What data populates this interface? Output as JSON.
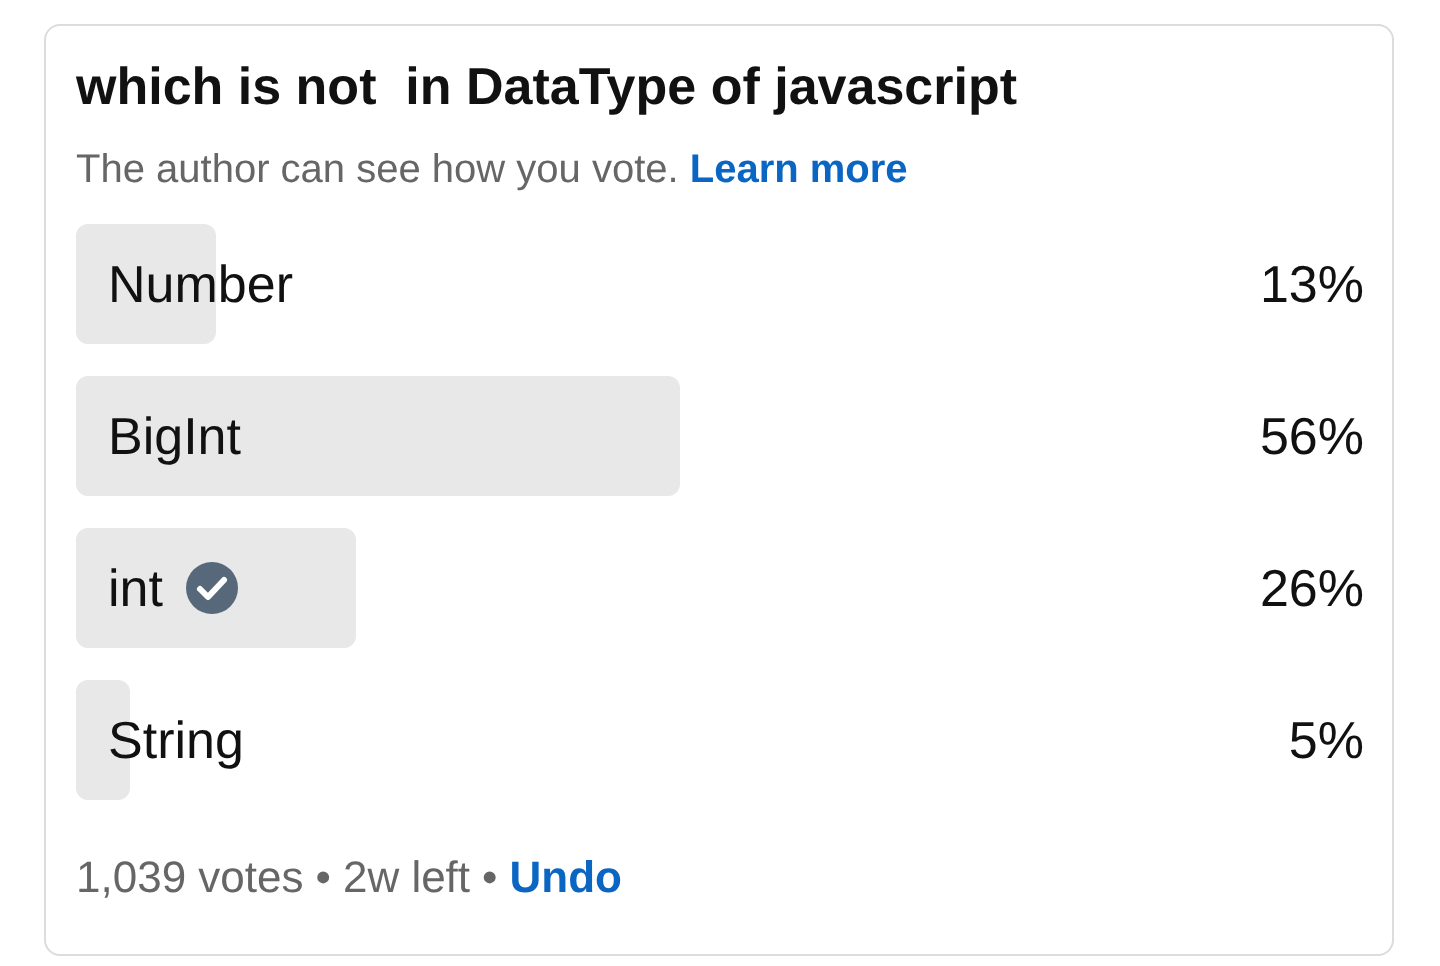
{
  "poll": {
    "question": "which is not  in DataType of javascript",
    "notice": "The author can see how you vote.",
    "learn_more": "Learn more",
    "options": [
      {
        "label": "Number",
        "percent": "13%",
        "selected": false
      },
      {
        "label": "BigInt",
        "percent": "56%",
        "selected": false
      },
      {
        "label": "int",
        "percent": "26%",
        "selected": true
      },
      {
        "label": "String",
        "percent": "5%",
        "selected": false
      }
    ],
    "votes": "1,039 votes",
    "separator_1": "•",
    "time_left": "2w left",
    "separator_2": "•",
    "undo": "Undo"
  }
}
